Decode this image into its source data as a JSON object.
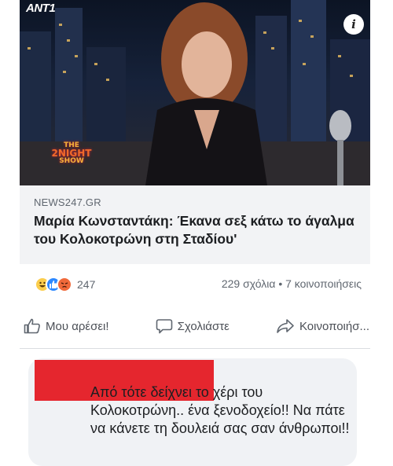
{
  "video": {
    "channel_logo": "ANT1",
    "info_icon": "i",
    "show_logo_line1": "THE",
    "show_logo_line2": "2NIGHT",
    "show_logo_line3": "SHOW"
  },
  "link_card": {
    "source": "NEWS247.GR",
    "headline": "Μαρία Κωνσταντάκη: Έκανα σεξ κάτω το άγαλμα του Κολοκοτρώνη στη Σταδίου'"
  },
  "reactions": {
    "types": [
      "haha-icon",
      "like-icon",
      "angry-icon"
    ],
    "count": "247"
  },
  "stats": {
    "text": "229 σχόλια • 7 κοινοποιήσεις"
  },
  "actions": {
    "like": "Μου αρέσει!",
    "comment": "Σχολιάστε",
    "share": "Κοινοποιήσ..."
  },
  "comment": {
    "text": "Από τότε δείχνει το χέρι του Κολοκοτρώνη.. ένα ξενοδοχείο!! Να πάτε να κάνετε τη δουλειά σας σαν άνθρωποι!!"
  },
  "colors": {
    "redaction": "#e5262e",
    "like_blue": "#2d88ff",
    "card_bg": "#f2f3f5"
  }
}
